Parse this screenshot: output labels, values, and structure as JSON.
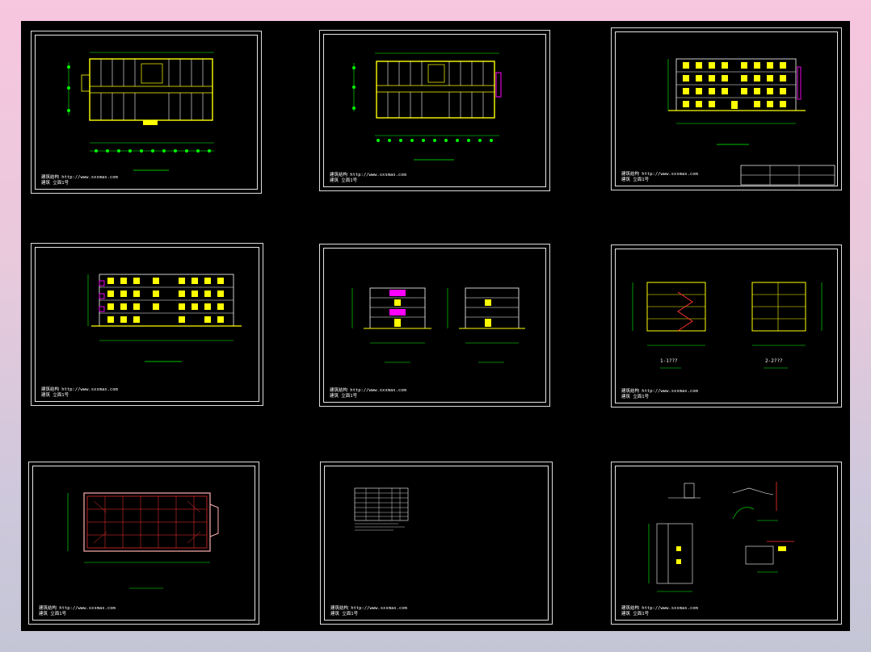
{
  "canvas_background": "#000000",
  "colors": {
    "wall": "#ffff00",
    "grid": "#00ff00",
    "accent": "#ff00ff",
    "red": "#ff3030",
    "frame": "#e6e6e6"
  },
  "sheets": [
    {
      "id": "s1",
      "stamp_line1": "建筑结构 http://www.sxsmas.com",
      "stamp_line2": "建筑 立面1号"
    },
    {
      "id": "s2",
      "stamp_line1": "建筑结构 http://www.sxsmas.com",
      "stamp_line2": "建筑 立面1号"
    },
    {
      "id": "s3",
      "stamp_line1": "建筑结构 http://www.sxsmas.com",
      "stamp_line2": "建筑 立面1号"
    },
    {
      "id": "s4",
      "stamp_line1": "建筑结构 http://www.sxsmas.com",
      "stamp_line2": "建筑 立面1号"
    },
    {
      "id": "s5",
      "stamp_line1": "建筑结构 http://www.sxsmas.com",
      "stamp_line2": "建筑 立面1号"
    },
    {
      "id": "s6",
      "stamp_line1": "建筑结构 http://www.sxsmas.com",
      "stamp_line2": "建筑 立面1号"
    },
    {
      "id": "s7",
      "stamp_line1": "建筑结构 http://www.sxsmas.com",
      "stamp_line2": "建筑 立面1号"
    },
    {
      "id": "s8",
      "stamp_line1": "建筑结构 http://www.sxsmas.com",
      "stamp_line2": "建筑 立面1号"
    },
    {
      "id": "s9",
      "stamp_line1": "建筑结构 http://www.sxsmas.com",
      "stamp_line2": "建筑 立面1号"
    }
  ],
  "section_labels": {
    "section_1": "1-1???",
    "section_2": "2-2???"
  }
}
